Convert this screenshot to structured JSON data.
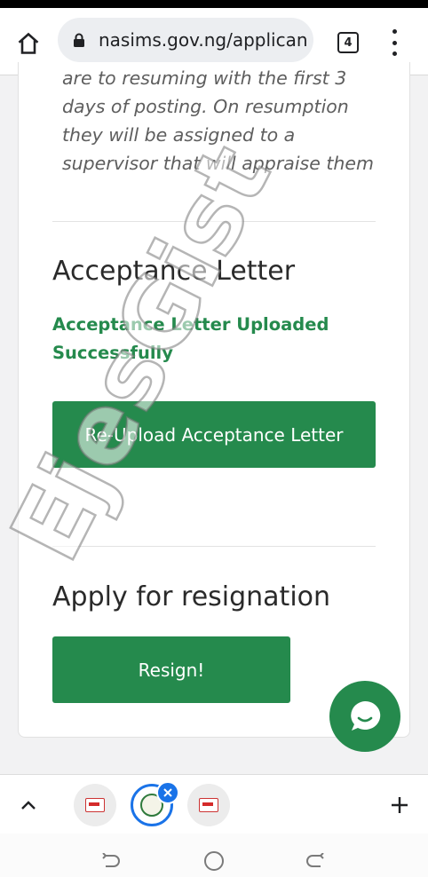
{
  "browser": {
    "url": "nasims.gov.ng/applicant",
    "tab_count": "4"
  },
  "content": {
    "posting_text": "are to resuming with the first 3 days of posting. On resumption they will be assigned to a supervisor that will appraise them",
    "acceptance_heading": "Acceptance Letter",
    "acceptance_status": "Acceptance Letter Uploaded Successfully",
    "reupload_label": "Re-Upload Acceptance Letter",
    "resignation_heading": "Apply for resignation",
    "resign_label": "Resign!"
  },
  "watermark": "EjesGist",
  "icons": {
    "home": "home-icon",
    "lock": "lock-icon",
    "menu": "more-vert-icon",
    "chat": "chat-bubble-icon",
    "expand": "chevron-up-icon",
    "add": "plus-icon",
    "close": "close-icon"
  },
  "colors": {
    "accent": "#258a4d",
    "tab_active": "#1a73e8"
  }
}
